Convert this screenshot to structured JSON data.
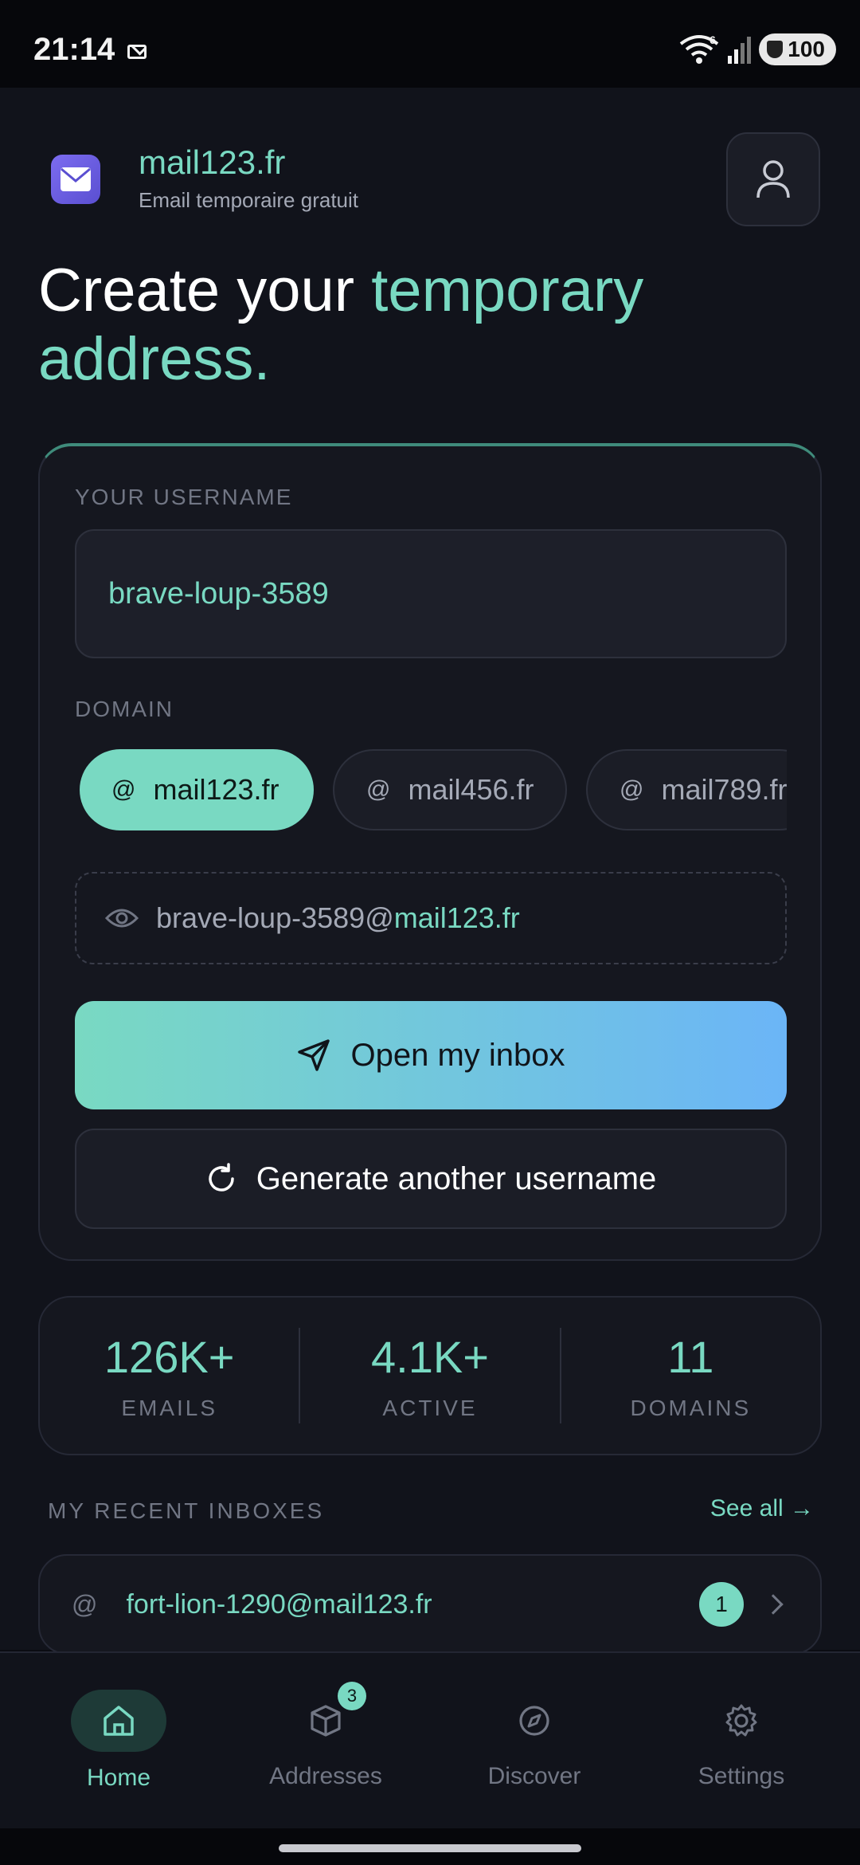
{
  "status": {
    "time": "21:14",
    "battery": "100",
    "wifi_badge": "6"
  },
  "brand": {
    "title": "mail123.fr",
    "subtitle": "Email temporaire gratuit"
  },
  "headline": {
    "part1": "Create your ",
    "accent": "temporary address."
  },
  "form": {
    "username_label": "YOUR USERNAME",
    "username_value": "brave-loup-3589",
    "domain_label": "DOMAIN",
    "domains": [
      {
        "name": "mail123.fr",
        "selected": true
      },
      {
        "name": "mail456.fr",
        "selected": false
      },
      {
        "name": "mail789.fr",
        "selected": false
      }
    ],
    "preview_user": "brave-loup-3589",
    "preview_at": "@",
    "preview_domain": "mail123.fr",
    "primary_button": "Open my inbox",
    "secondary_button": "Generate another username"
  },
  "stats": [
    {
      "value": "126K+",
      "label": "EMAILS"
    },
    {
      "value": "4.1K+",
      "label": "ACTIVE"
    },
    {
      "value": "11",
      "label": "DOMAINS"
    }
  ],
  "recent": {
    "label": "MY RECENT INBOXES",
    "see_all": "See all →",
    "items": [
      {
        "address": "fort-lion-1290@mail123.fr",
        "count": "1"
      }
    ]
  },
  "nav": {
    "items": [
      {
        "label": "Home",
        "icon": "home-icon",
        "active": true
      },
      {
        "label": "Addresses",
        "icon": "box-icon",
        "badge": "3"
      },
      {
        "label": "Discover",
        "icon": "compass-icon"
      },
      {
        "label": "Settings",
        "icon": "gear-icon"
      }
    ]
  },
  "colors": {
    "accent": "#79d9c2",
    "gradient_end": "#6bb5f7",
    "background": "#11131b",
    "card": "#15171f"
  }
}
